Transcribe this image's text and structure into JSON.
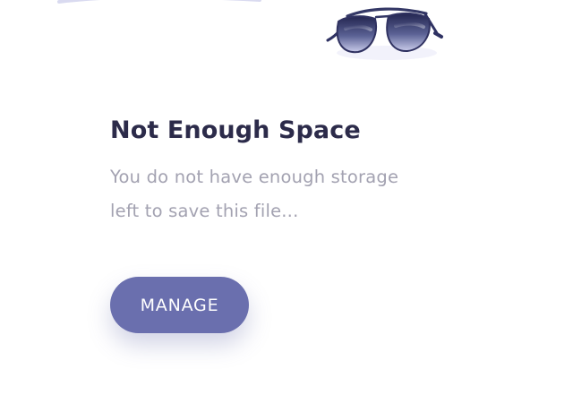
{
  "dialog": {
    "title": "Not Enough Space",
    "message": "You do not have enough storage left to save this file...",
    "button_label": "MANAGE",
    "illustration_icon": "sunglasses-icon"
  },
  "colors": {
    "accent": "#6a6fae",
    "title": "#2c2b4a",
    "muted_text": "#a3a2b1",
    "background": "#ffffff"
  }
}
